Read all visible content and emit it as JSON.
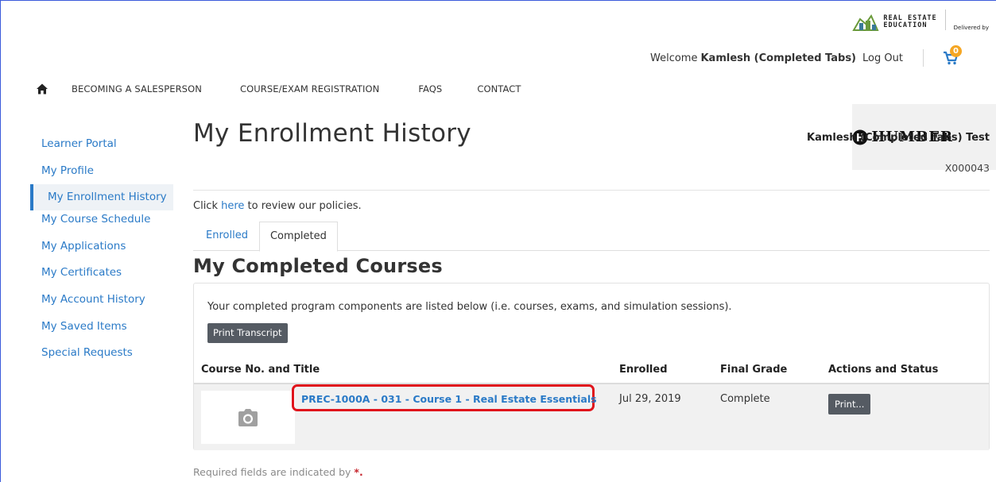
{
  "header": {
    "brand_primary": "REAL ESTATE",
    "brand_secondary": "EDUCATION",
    "delivered_by": "Delivered by",
    "humber": "HUMBER",
    "welcome_text": "Welcome",
    "user_display": "Kamlesh (Completed Tabs)",
    "logout": "Log Out",
    "cart_count": "0"
  },
  "nav": {
    "items": [
      "BECOMING A SALESPERSON",
      "COURSE/EXAM REGISTRATION",
      "FAQS",
      "CONTACT"
    ]
  },
  "sidebar": {
    "items": [
      {
        "label": "Learner Portal"
      },
      {
        "label": "My Profile"
      },
      {
        "label": "My Enrollment History",
        "active": true
      },
      {
        "label": "My Course Schedule"
      },
      {
        "label": "My Applications"
      },
      {
        "label": "My Certificates"
      },
      {
        "label": "My Account History"
      },
      {
        "label": "My Saved Items"
      },
      {
        "label": "Special Requests"
      }
    ]
  },
  "main": {
    "title": "My Enrollment History",
    "user_full_name": "Kamlesh (Completed Tabs) Test",
    "user_id": "X000043",
    "policy_prefix": "Click ",
    "policy_link": "here",
    "policy_suffix": " to review our policies.",
    "tabs": [
      {
        "label": "Enrolled",
        "active": false
      },
      {
        "label": "Completed",
        "active": true
      }
    ],
    "section_title": "My Completed Courses",
    "description": "Your completed program components are listed below (i.e. courses, exams, and simulation sessions).",
    "print_transcript": "Print Transcript",
    "table": {
      "headers": [
        "Course No. and Title",
        "Enrolled",
        "Final Grade",
        "Actions and Status"
      ],
      "rows": [
        {
          "title": "PREC-1000A - 031 - Course 1 - Real Estate Essentials",
          "enrolled": "Jul 29, 2019",
          "grade": "Complete",
          "action": "Print..."
        }
      ]
    },
    "required_note": "Required fields are indicated by",
    "required_star": "*."
  },
  "colors": {
    "link": "#2a7ac7",
    "button": "#555b63",
    "highlight": "#e0141c",
    "badge": "#f5a623"
  },
  "icons": [
    "home-icon",
    "cart-icon",
    "camera-icon",
    "real-estate-logo-icon",
    "humber-logo-icon"
  ]
}
